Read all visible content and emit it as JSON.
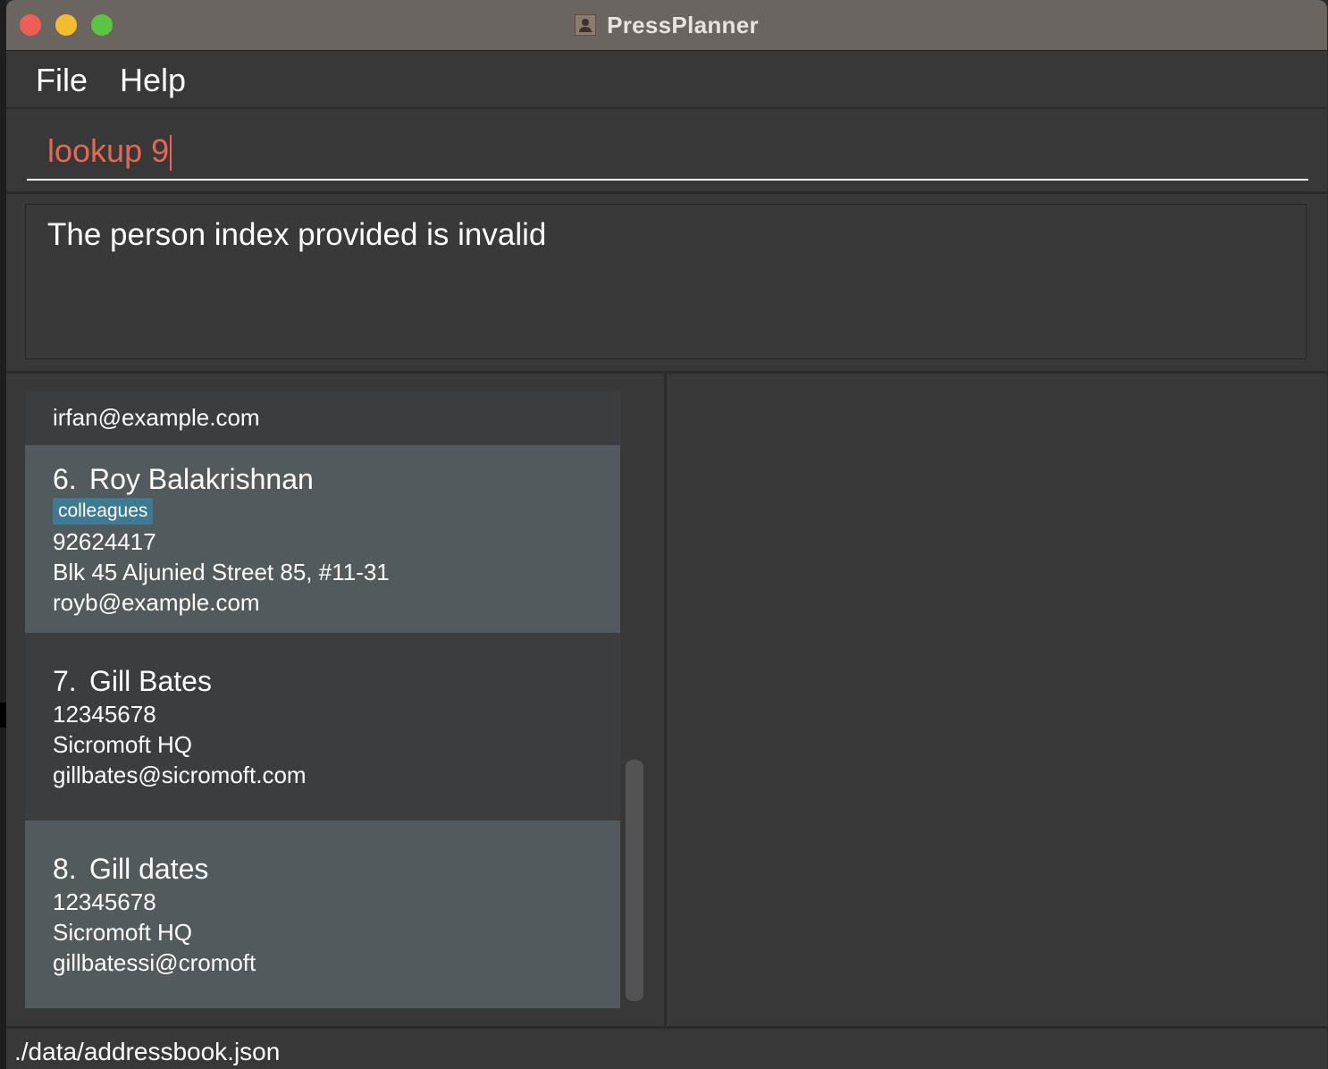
{
  "window": {
    "title": "PressPlanner"
  },
  "menu": {
    "items": [
      "File",
      "Help"
    ]
  },
  "command": {
    "value": "lookup 9"
  },
  "result": {
    "message": "The person index provided is invalid"
  },
  "persons": [
    {
      "email": "irfan@example.com"
    },
    {
      "index": "6.",
      "name": "Roy Balakrishnan",
      "tag": "colleagues",
      "phone": "92624417",
      "address": "Blk 45 Aljunied Street 85, #11-31",
      "email": "royb@example.com"
    },
    {
      "index": "7.",
      "name": "Gill Bates",
      "phone": "12345678",
      "address": "Sicromoft HQ",
      "email": "gillbates@sicromoft.com"
    },
    {
      "index": "8.",
      "name": "Gill dates",
      "phone": "12345678",
      "address": "Sicromoft HQ",
      "email": "gillbatessi@cromoft"
    }
  ],
  "status": {
    "file_path": "./data/addressbook.json"
  },
  "colors": {
    "command_text": "#e36955",
    "tag_background": "#3e7b91",
    "card_light": "#535a5d",
    "card_dark": "#3c3d3f"
  }
}
